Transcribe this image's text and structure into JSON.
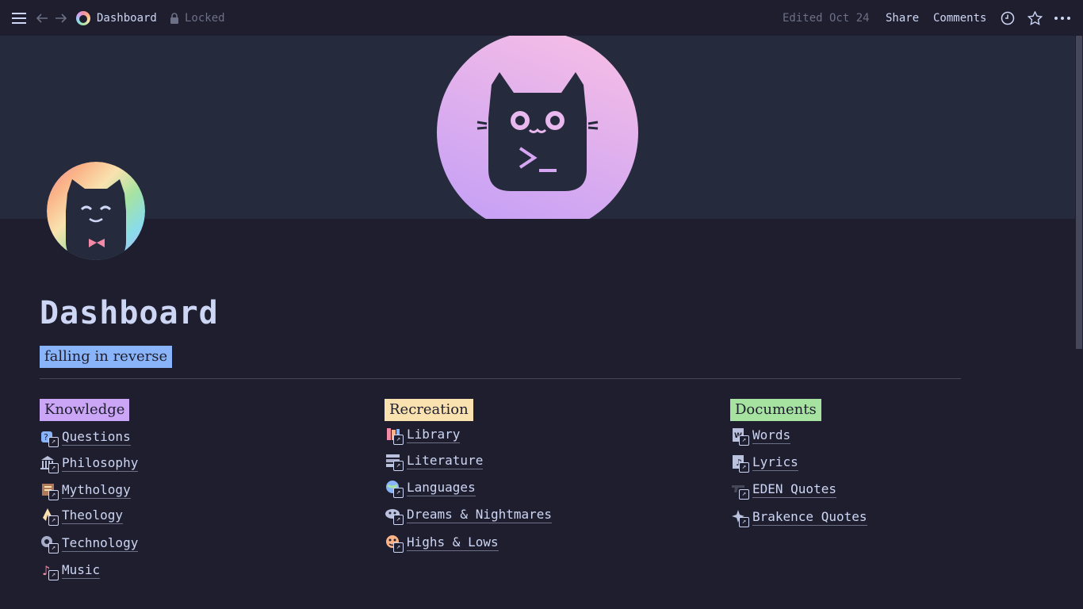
{
  "topbar": {
    "menu_icon": "hamburger-menu-icon",
    "back_icon": "arrow-left-icon",
    "forward_icon": "arrow-right-icon",
    "breadcrumb_title": "Dashboard",
    "lock_label": "Locked",
    "edited": "Edited Oct 24",
    "share_label": "Share",
    "comments_label": "Comments",
    "updates_icon": "clock-icon",
    "favorite_icon": "star-icon",
    "more_icon": "more-horizontal-icon"
  },
  "page": {
    "title": "Dashboard",
    "subtitle_tag": "falling in reverse"
  },
  "sections": [
    {
      "heading": "Knowledge",
      "color": "#cba6f7",
      "items": [
        {
          "label": "Questions",
          "icon": "question-blocks-icon"
        },
        {
          "label": "Philosophy",
          "icon": "classical-building-icon"
        },
        {
          "label": "Mythology",
          "icon": "scroll-icon"
        },
        {
          "label": "Theology",
          "icon": "praying-hands-icon"
        },
        {
          "label": "Technology",
          "icon": "gear-head-icon"
        },
        {
          "label": "Music",
          "icon": "treble-clef-icon"
        }
      ]
    },
    {
      "heading": "Recreation",
      "color": "#f9e2af",
      "items": [
        {
          "label": "Library",
          "icon": "books-icon"
        },
        {
          "label": "Literature",
          "icon": "bookshelf-icon"
        },
        {
          "label": "Languages",
          "icon": "globe-speech-icon"
        },
        {
          "label": "Dreams & Nightmares",
          "icon": "cloud-face-icon"
        },
        {
          "label": "Highs & Lows",
          "icon": "mood-icon"
        }
      ]
    },
    {
      "heading": "Documents",
      "color": "#a6e3a1",
      "items": [
        {
          "label": "Words",
          "icon": "word-document-icon"
        },
        {
          "label": "Lyrics",
          "icon": "sheet-music-icon"
        },
        {
          "label": "EDEN Quotes",
          "icon": "gun-icon"
        },
        {
          "label": "Brakence Quotes",
          "icon": "sparkle-icon"
        }
      ]
    }
  ],
  "colors": {
    "background": "#1e1e2e",
    "cover_background": "#262a3d",
    "subtitle_tag": "#89b4fa",
    "text": "#cdd6f4",
    "muted": "#6c7086"
  }
}
